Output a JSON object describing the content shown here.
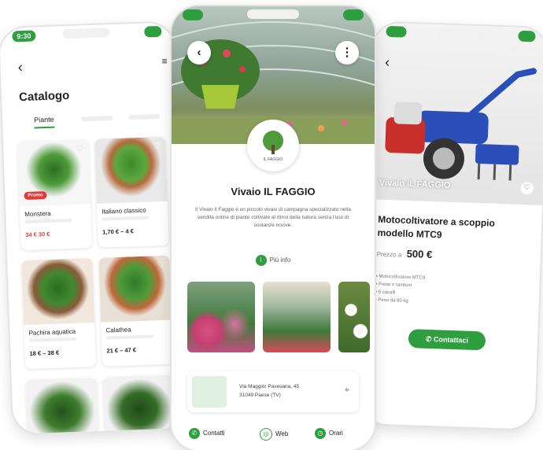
{
  "status": {
    "time": "9:30"
  },
  "catalog": {
    "title": "Catalogo",
    "tabs": [
      "Piante",
      "",
      ""
    ],
    "products": [
      {
        "name": "Monstera",
        "price": "34 €   30 €",
        "badge": "Promo"
      },
      {
        "name": "Italiano classico",
        "price": "1,70 € – 4 €",
        "badge": ""
      },
      {
        "name": "Pachira aquatica",
        "price": "18 € – 38 €",
        "badge": ""
      },
      {
        "name": "Calathea",
        "price": "21 € – 47 €",
        "badge": ""
      }
    ]
  },
  "nursery": {
    "logo_text": "IL FAGGIO",
    "title": "Vivaio IL FAGGIO",
    "description": "Il Vivaio Il Faggio è un piccolo vivaio di campagna specializzato nella vendita online di piante coltivate al ritmo della natura senza l'uso di sostanze nocive.",
    "more_info": "Più info",
    "address_line1": "Via Maggior Pavesana, 45",
    "address_line2": "31049 Paese (TV)",
    "actions": [
      "Contatti",
      "Web",
      "Orari"
    ]
  },
  "product_detail": {
    "image_caption": "Vivaio IL FAGGIO",
    "title": "Motocoltivatore a scoppio modello MTC9",
    "price_label": "Prezzo a",
    "price": "500 €",
    "features": [
      "Motocoltivatore MTC9",
      "Frese e tamburi",
      "5 cavalli",
      "Peso da 80 kg"
    ],
    "contact_label": "Contattaci"
  },
  "colors": {
    "accent": "#2f9e3f",
    "promo": "#e23b3b"
  }
}
